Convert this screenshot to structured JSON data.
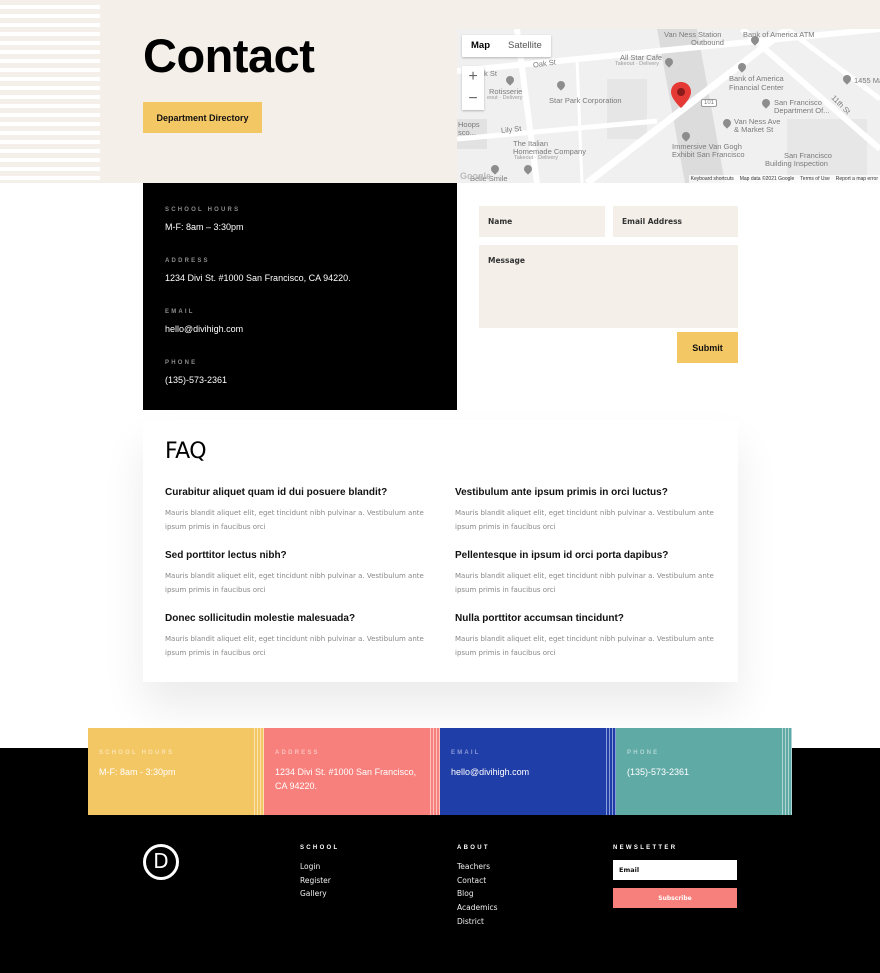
{
  "hero": {
    "title": "Contact",
    "button_label": "Department Directory"
  },
  "map": {
    "type_controls": [
      "Map",
      "Satellite"
    ],
    "active_type": "Map",
    "zoom_in": "+",
    "zoom_out": "−",
    "labels": [
      {
        "text": "Oak St",
        "kind": "street"
      },
      {
        "text": "k St",
        "kind": "street"
      },
      {
        "text": "Lily St",
        "kind": "street"
      },
      {
        "text": "11th St",
        "kind": "street"
      },
      {
        "text": "Van Ness Station",
        "kind": "poi"
      },
      {
        "text": "Outbound",
        "kind": "poi"
      },
      {
        "text": "Bank of America ATM",
        "kind": "poi"
      },
      {
        "text": "All Star Cafe",
        "kind": "poi"
      },
      {
        "text": "Takeout · Delivery",
        "kind": "sub"
      },
      {
        "text": "Rotisserie",
        "kind": "poi"
      },
      {
        "text": "eout · Delivery",
        "kind": "sub"
      },
      {
        "text": "Star Park Corporation",
        "kind": "poi"
      },
      {
        "text": "Bank of America",
        "kind": "poi"
      },
      {
        "text": "Financial Center",
        "kind": "poi"
      },
      {
        "text": "1455 Ma",
        "kind": "poi"
      },
      {
        "text": "San Francisco",
        "kind": "poi"
      },
      {
        "text": "Department Of...",
        "kind": "poi"
      },
      {
        "text": "Van Ness Ave",
        "kind": "poi"
      },
      {
        "text": "& Market St",
        "kind": "poi"
      },
      {
        "text": "Hoops",
        "kind": "poi"
      },
      {
        "text": "sco...",
        "kind": "poi"
      },
      {
        "text": "The Italian",
        "kind": "poi"
      },
      {
        "text": "Homemade Company",
        "kind": "poi"
      },
      {
        "text": "Takeout · Delivery",
        "kind": "sub"
      },
      {
        "text": "Immersive Van Gogh",
        "kind": "poi"
      },
      {
        "text": "Exhibit San Francisco",
        "kind": "poi"
      },
      {
        "text": "San Francisco",
        "kind": "poi"
      },
      {
        "text": "Building Inspection",
        "kind": "poi"
      },
      {
        "text": "Belle Smile",
        "kind": "poi"
      },
      {
        "text": "101",
        "kind": "shield"
      }
    ],
    "google_logo": "Google",
    "footer_links": [
      "Keyboard shortcuts",
      "Map data ©2021 Google",
      "Terms of Use",
      "Report a map error"
    ],
    "pin_color": "#e53935"
  },
  "info": [
    {
      "label": "SCHOOL HOURS",
      "value": "M-F: 8am – 3:30pm"
    },
    {
      "label": "ADDRESS",
      "value": "1234 Divi St. #1000 San Francisco, CA 94220."
    },
    {
      "label": "EMAIL",
      "value": "hello@divihigh.com"
    },
    {
      "label": "PHONE",
      "value": "(135)-573-2361"
    }
  ],
  "form": {
    "name_placeholder": "Name",
    "email_placeholder": "Email Address",
    "message_placeholder": "Message",
    "submit_label": "Submit"
  },
  "faq": {
    "title": "FAQ",
    "items": [
      {
        "q": "Curabitur aliquet quam id dui posuere blandit?",
        "a": "Mauris blandit aliquet elit, eget tincidunt nibh pulvinar a. Vestibulum ante ipsum primis in faucibus orci"
      },
      {
        "q": "Sed porttitor lectus nibh?",
        "a": "Mauris blandit aliquet elit, eget tincidunt nibh pulvinar a. Vestibulum ante ipsum primis in faucibus orci"
      },
      {
        "q": "Donec sollicitudin molestie malesuada?",
        "a": "Mauris blandit aliquet elit, eget tincidunt nibh pulvinar a. Vestibulum ante ipsum primis in faucibus orci"
      },
      {
        "q": "Vestibulum ante ipsum primis in orci luctus?",
        "a": "Mauris blandit aliquet elit, eget tincidunt nibh pulvinar a. Vestibulum ante ipsum primis in faucibus orci"
      },
      {
        "q": "Pellentesque in ipsum id orci porta dapibus?",
        "a": "Mauris blandit aliquet elit, eget tincidunt nibh pulvinar a. Vestibulum ante ipsum primis in faucibus orci"
      },
      {
        "q": "Nulla porttitor accumsan tincidunt?",
        "a": "Mauris blandit aliquet elit, eget tincidunt nibh pulvinar a. Vestibulum ante ipsum primis in faucibus orci"
      }
    ]
  },
  "tiles": [
    {
      "label": "SCHOOL HOURS",
      "value": "M-F: 8am - 3:30pm",
      "color": "#f4c765",
      "label_color": "#fbe3b0"
    },
    {
      "label": "ADDRESS",
      "value": "1234 Divi St. #1000 San Francisco, CA 94220.",
      "color": "#f7807c",
      "label_color": "#fcc2bf"
    },
    {
      "label": "EMAIL",
      "value": "hello@divihigh.com",
      "color": "#203ea8",
      "label_color": "#8b9ad8"
    },
    {
      "label": "PHONE",
      "value": "(135)-573-2361",
      "color": "#60aaa6",
      "label_color": "#b0d6d3"
    }
  ],
  "footer": {
    "logo_letter": "D",
    "columns": [
      {
        "heading": "SCHOOL",
        "links": [
          "Login",
          "Register",
          "Gallery"
        ]
      },
      {
        "heading": "ABOUT",
        "links": [
          "Teachers",
          "Contact",
          "Blog",
          "Academics",
          "District"
        ]
      }
    ],
    "newsletter": {
      "heading": "NEWSLETTER",
      "email_placeholder": "Email",
      "button_label": "Subscribe"
    }
  }
}
